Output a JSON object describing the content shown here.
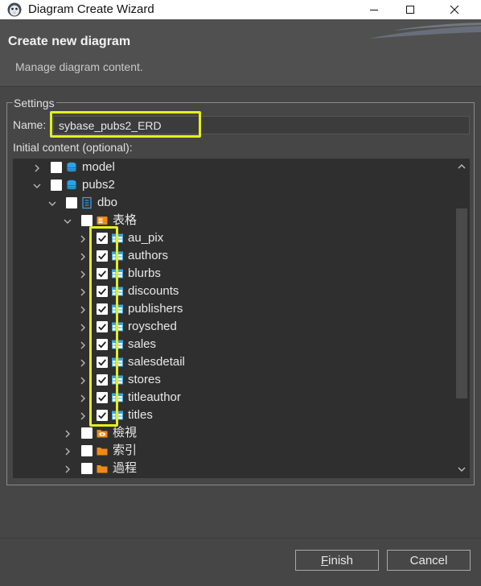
{
  "window": {
    "title": "Diagram Create Wizard"
  },
  "header": {
    "heading": "Create new diagram",
    "subheading": "Manage diagram content."
  },
  "settings": {
    "legend": "Settings",
    "name_label": "Name:",
    "name_value": "sybase_pubs2_ERD",
    "initial_content_label": "Initial content (optional):"
  },
  "tree": {
    "rows": [
      {
        "label": "model",
        "expanded": false,
        "checked": false,
        "icon": "database-icon"
      },
      {
        "label": "pubs2",
        "expanded": true,
        "checked": false,
        "icon": "database-icon"
      },
      {
        "label": "dbo",
        "expanded": true,
        "checked": false,
        "icon": "schema-icon"
      },
      {
        "label": "表格",
        "expanded": true,
        "checked": false,
        "icon": "tables-folder-icon"
      },
      {
        "label": "au_pix",
        "expanded": false,
        "checked": true,
        "icon": "table-icon"
      },
      {
        "label": "authors",
        "expanded": false,
        "checked": true,
        "icon": "table-icon"
      },
      {
        "label": "blurbs",
        "expanded": false,
        "checked": true,
        "icon": "table-icon"
      },
      {
        "label": "discounts",
        "expanded": false,
        "checked": true,
        "icon": "table-icon"
      },
      {
        "label": "publishers",
        "expanded": false,
        "checked": true,
        "icon": "table-icon"
      },
      {
        "label": "roysched",
        "expanded": false,
        "checked": true,
        "icon": "table-icon"
      },
      {
        "label": "sales",
        "expanded": false,
        "checked": true,
        "icon": "table-icon"
      },
      {
        "label": "salesdetail",
        "expanded": false,
        "checked": true,
        "icon": "table-icon"
      },
      {
        "label": "stores",
        "expanded": false,
        "checked": true,
        "icon": "table-icon"
      },
      {
        "label": "titleauthor",
        "expanded": false,
        "checked": true,
        "icon": "table-icon"
      },
      {
        "label": "titles",
        "expanded": false,
        "checked": true,
        "icon": "table-icon"
      },
      {
        "label": "檢視",
        "expanded": false,
        "checked": false,
        "icon": "views-folder-icon"
      },
      {
        "label": "索引",
        "expanded": false,
        "checked": false,
        "icon": "folder-icon"
      },
      {
        "label": "過程",
        "expanded": false,
        "checked": false,
        "icon": "folder-icon"
      }
    ]
  },
  "buttons": {
    "finish_mnemonic": "F",
    "finish_rest": "inish",
    "cancel": "Cancel"
  },
  "colors": {
    "highlight": "#e3f01e",
    "table_icon": "#3aa8e0",
    "folder_icon": "#f08a16",
    "database_icon": "#2fa0e8"
  }
}
